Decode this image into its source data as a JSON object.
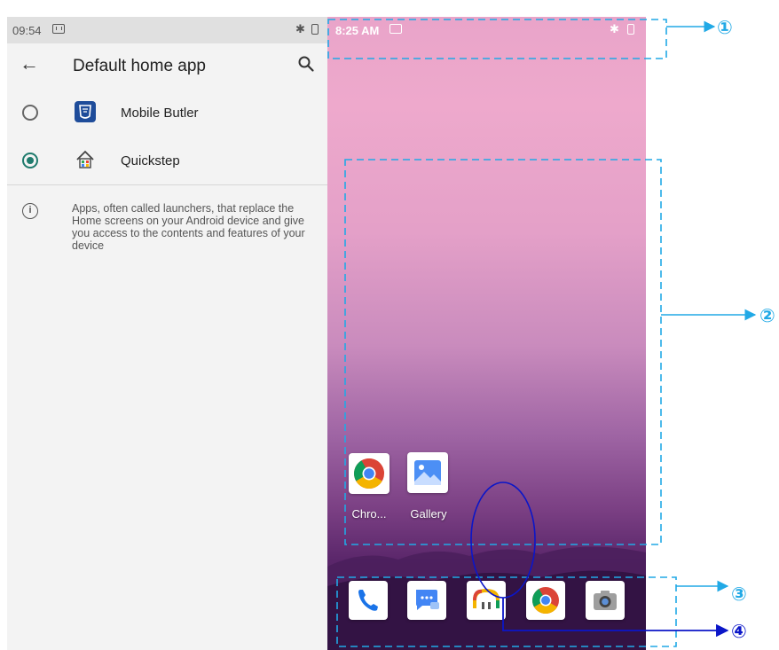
{
  "settings": {
    "status_bar": {
      "time": "09:54"
    },
    "toolbar": {
      "title": "Default home app"
    },
    "options": [
      {
        "label": "Mobile Butler",
        "selected": false,
        "icon": "mobile-butler-icon"
      },
      {
        "label": "Quickstep",
        "selected": true,
        "icon": "quickstep-icon"
      }
    ],
    "info_text": "Apps, often called launchers, that replace the Home screens on your Android device and give you access to the contents and features of your device",
    "accent_color": "#1f7b6d"
  },
  "home": {
    "status_bar": {
      "time": "8:25 AM"
    },
    "workspace_apps": [
      {
        "label": "Chro...",
        "icon": "chrome-icon"
      },
      {
        "label": "Gallery",
        "icon": "gallery-icon"
      }
    ],
    "dock_apps": [
      {
        "icon": "phone-icon"
      },
      {
        "icon": "messages-icon"
      },
      {
        "icon": "app-drawer-icon"
      },
      {
        "icon": "chrome-icon"
      },
      {
        "icon": "camera-icon"
      }
    ]
  },
  "annotations": {
    "callouts": [
      "①",
      "②",
      "③",
      "④"
    ],
    "box_color": "#21a9e6",
    "circle_color": "#0b16c8"
  }
}
